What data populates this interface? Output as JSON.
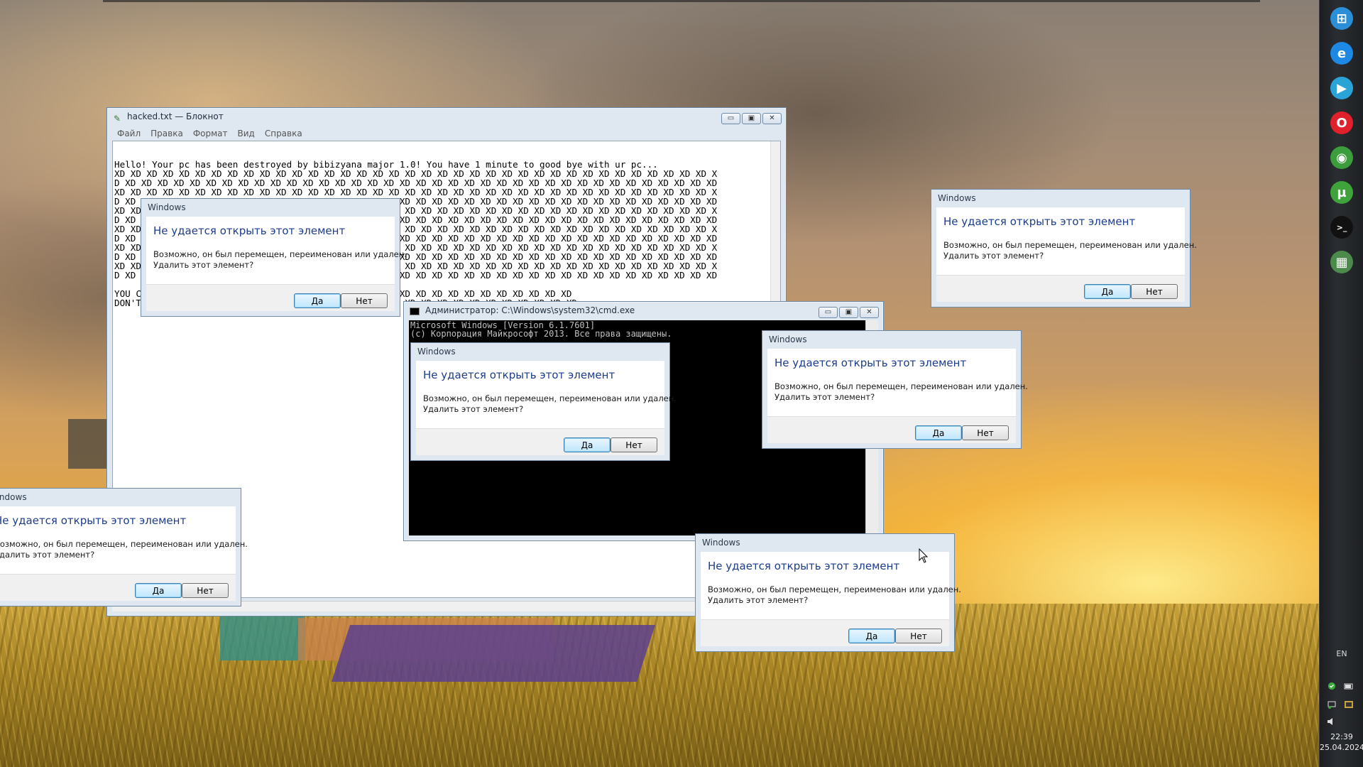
{
  "notepad": {
    "title": "hacked.txt — Блокнот",
    "menu": [
      "Файл",
      "Правка",
      "Формат",
      "Вид",
      "Справка"
    ],
    "text": "Hello! Your pc has been destroyed by bibizyana major 1.0! You have 1 minute to good bye with ur pc...\nXD XD XD XD XD XD XD XD XD XD XD XD XD XD XD XD XD XD XD XD XD XD XD XD XD XD XD XD XD XD XD XD XD XD XD XD XD X\nD XD XD XD XD XD XD XD XD XD XD XD XD XD XD XD XD XD XD XD XD XD XD XD XD XD XD XD XD XD XD XD XD XD XD XD XD XD\nXD XD XD XD XD XD XD XD XD XD XD XD XD XD XD XD XD XD XD XD XD XD XD XD XD XD XD XD XD XD XD XD XD XD XD XD XD X\nD XD XD XD XD XD XD XD XD XD XD XD XD XD XD XD XD XD XD XD XD XD XD XD XD XD XD XD XD XD XD XD XD XD XD XD XD XD\nXD XD XD XD XD XD XD XD XD XD XD XD XD XD XD XD XD XD XD XD XD XD XD XD XD XD XD XD XD XD XD XD XD XD XD XD XD X\nD XD XD XD XD XD XD XD XD XD XD XD XD XD XD XD XD XD XD XD XD XD XD XD XD XD XD XD XD XD XD XD XD XD XD XD XD XD\nXD XD XD XD XD XD XD XD XD XD XD XD XD XD XD XD XD XD XD XD XD XD XD XD XD XD XD XD XD XD XD XD XD XD XD XD XD X\nD XD XD XD XD XD XD XD XD XD XD XD XD XD XD XD XD XD XD XD XD XD XD XD XD XD XD XD XD XD XD XD XD XD XD XD XD XD\nXD XD XD XD XD XD XD XD XD XD XD XD XD XD XD XD XD XD XD XD XD XD XD XD XD XD XD XD XD XD XD XD XD XD XD XD XD X\nD XD XD XD XD XD XD XD XD XD XD XD XD XD XD XD XD XD XD XD XD XD XD XD XD XD XD XD XD XD XD XD XD XD XD XD XD XD\nXD XD XD XD XD XD XD XD XD XD XD XD XD XD XD XD XD XD XD XD XD XD XD XD XD XD XD XD XD XD XD XD XD XD XD XD XD X\nD XD XD XD XD XD XD XD XD XD XD XD XD XD XD XD XD XD XD XD XD XD XD XD XD XD XD XD XD XD XD XD XD XD XD XD XD XD\n\nYOU CAN'T ESCAPE XD XD XD XD XD XD XD XD XD XD XD XD XD XD XD XD XD XD XD XD XD XD XD\nDON'T EVEN TRY XD XD XD XD XD XD XD XD XD XD XD XD XD XD XD XD XD XD XD XD XD XD XD XD"
  },
  "cmd": {
    "title": "Администратор: C:\\Windows\\system32\\cmd.exe",
    "console": "Microsoft Windows [Version 6.1.7601]\n(c) Корпорация Майкрософт 2013. Все права защищены."
  },
  "dialog": {
    "title": "Windows",
    "heading": "Не удается открыть этот элемент",
    "message": "Возможно, он был перемещен, переименован или удален.\nУдалить этот элемент?",
    "yes": "Да",
    "no": "Нет"
  },
  "window_controls": {
    "minimize": "▭",
    "maximize": "▣",
    "close": "✕"
  },
  "taskbar": {
    "pinned": [
      {
        "name": "windows-start-icon",
        "glyph": "⊞",
        "color": "#2a8fd6"
      },
      {
        "name": "internet-explorer-icon",
        "glyph": "e",
        "color": "#1e88e5"
      },
      {
        "name": "media-player-icon",
        "glyph": "▶",
        "color": "#2aa4d6"
      },
      {
        "name": "opera-icon",
        "glyph": "O",
        "color": "#e0202a"
      },
      {
        "name": "chrome-icon",
        "glyph": "◉",
        "color": "#3b9d3b"
      },
      {
        "name": "utorrent-icon",
        "glyph": "µ",
        "color": "#3fa23a"
      },
      {
        "name": "cmd-icon",
        "glyph": ">_",
        "color": "#111111"
      },
      {
        "name": "network-app-icon",
        "glyph": "▦",
        "color": "#4c8a4c"
      }
    ],
    "language": "EN",
    "time": "22:39",
    "date": "25.04.2024"
  }
}
